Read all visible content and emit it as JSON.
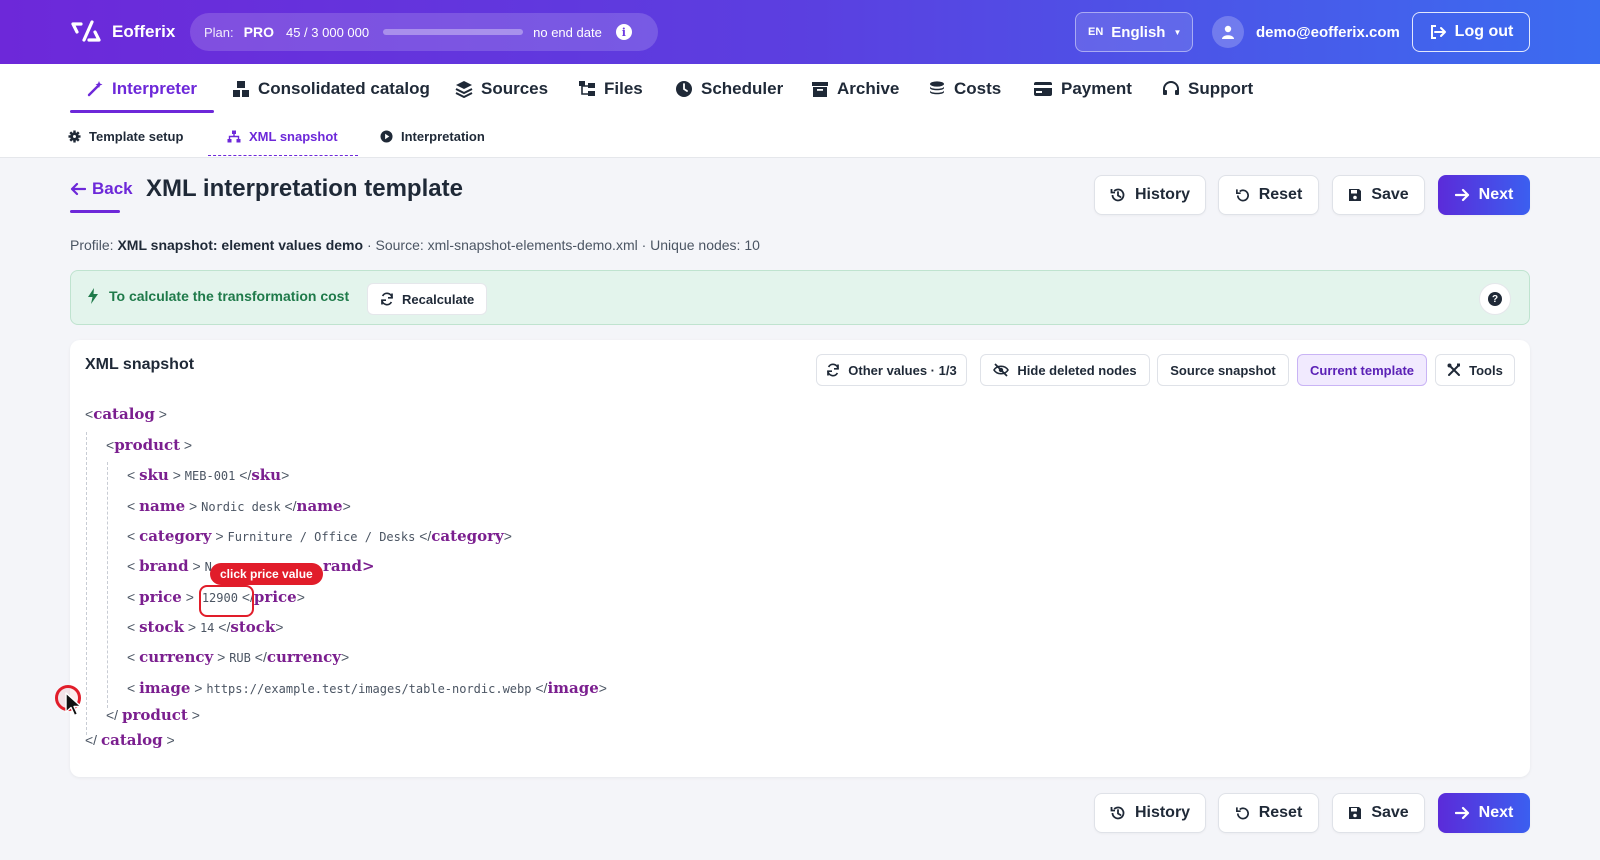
{
  "app": {
    "name": "Eofferix",
    "plan_label": "Plan:",
    "plan_name": "PRO",
    "usage_text": "45 / 3 000 000",
    "usage_fraction": 1.5e-05,
    "end_date": "no end date",
    "language_code": "EN",
    "language_name": "English",
    "user_email": "demo@eofferix.com",
    "logout_label": "Log out"
  },
  "main_nav": [
    {
      "label": "Interpreter",
      "icon": "magic-wand-icon",
      "active": true
    },
    {
      "label": "Consolidated catalog",
      "icon": "boxes-icon"
    },
    {
      "label": "Sources",
      "icon": "layers-icon"
    },
    {
      "label": "Files",
      "icon": "folder-tree-icon"
    },
    {
      "label": "Scheduler",
      "icon": "clock-icon"
    },
    {
      "label": "Archive",
      "icon": "archive-box-icon"
    },
    {
      "label": "Costs",
      "icon": "coins-icon"
    },
    {
      "label": "Payment",
      "icon": "credit-card-icon"
    },
    {
      "label": "Support",
      "icon": "headset-icon"
    }
  ],
  "sub_nav": [
    {
      "label": "Template setup",
      "icon": "gear-icon"
    },
    {
      "label": "XML snapshot",
      "icon": "sitemap-icon",
      "active": true
    },
    {
      "label": "Interpretation",
      "icon": "play-circle-icon"
    }
  ],
  "page": {
    "back_label": "Back",
    "title": "XML interpretation template",
    "actions": {
      "history": "History",
      "reset": "Reset",
      "save": "Save",
      "next": "Next"
    },
    "profile_prefix": "Profile:",
    "profile_name": "XML snapshot: element values demo",
    "source_text": " · Source: xml-snapshot-elements-demo.xml · Unique nodes: 10"
  },
  "alert": {
    "text": "To calculate the transformation cost",
    "button": "Recalculate",
    "help": "?"
  },
  "snapshot": {
    "title": "XML snapshot",
    "tools": {
      "other_values": "Other values · 1/3",
      "hide_deleted": "Hide deleted nodes",
      "source_snapshot": "Source snapshot",
      "current_template": "Current template",
      "tools": "Tools"
    },
    "root": "catalog",
    "item": "product",
    "fields": [
      {
        "tag": "sku",
        "value": "MEB-001"
      },
      {
        "tag": "name",
        "value": "Nordic desk"
      },
      {
        "tag": "category",
        "value": "Furniture / Office / Desks"
      },
      {
        "tag": "brand",
        "value": "N"
      },
      {
        "tag": "price",
        "value": "12900"
      },
      {
        "tag": "stock",
        "value": "14"
      },
      {
        "tag": "currency",
        "value": "RUB"
      },
      {
        "tag": "image",
        "value": "https://example.test/images/table-nordic.webp"
      }
    ]
  },
  "annotation": {
    "tooltip": "click price value",
    "brand_tail": "rand>"
  },
  "colors": {
    "accent": "#6d28d9",
    "tag": "#7b1f8f",
    "alert_bg": "#e3f4ec",
    "alert_text": "#1f7a4a",
    "highlight": "#e11d2a"
  }
}
